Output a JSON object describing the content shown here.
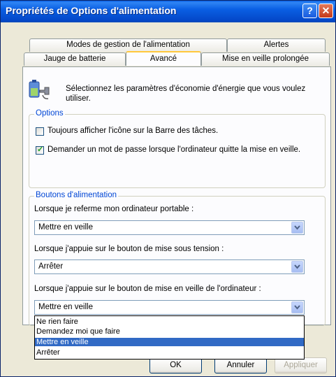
{
  "window": {
    "title": "Propriétés de Options d'alimentation",
    "help_glyph": "?",
    "close_glyph": "✕"
  },
  "tabs": {
    "row1": [
      "Modes de gestion de l'alimentation",
      "Alertes"
    ],
    "row2": [
      "Jauge de batterie",
      "Avancé",
      "Mise en veille prolongée"
    ],
    "active": "Avancé"
  },
  "panel": {
    "intro": "Sélectionnez les paramètres d'économie d'énergie que vous voulez utiliser.",
    "options": {
      "legend": "Options",
      "checkbox1_label": "Toujours afficher l'icône sur la Barre des tâches.",
      "checkbox1_checked": false,
      "checkbox2_label": "Demander un mot de passe lorsque l'ordinateur quitte la mise en veille.",
      "checkbox2_checked": true
    },
    "power_buttons": {
      "legend": "Boutons d'alimentation",
      "lid_label": "Lorsque je referme mon ordinateur portable :",
      "lid_value": "Mettre en veille",
      "power_label": "Lorsque j'appuie sur le bouton de mise sous tension :",
      "power_value": "Arrêter",
      "sleep_label": "Lorsque j'appuie sur le bouton de mise en veille de l'ordinateur :",
      "sleep_value": "Mettre en veille",
      "sleep_options": [
        "Ne rien faire",
        "Demandez moi que faire",
        "Mettre en veille",
        "Arrêter"
      ],
      "sleep_selected": "Mettre en veille"
    }
  },
  "footer": {
    "ok": "OK",
    "cancel": "Annuler",
    "apply": "Appliquer"
  },
  "colors": {
    "titlebar": "#0a5fe3",
    "legend_text": "#0046d5",
    "selection": "#316ac5",
    "active_tab_accent": "#ffc83c"
  }
}
